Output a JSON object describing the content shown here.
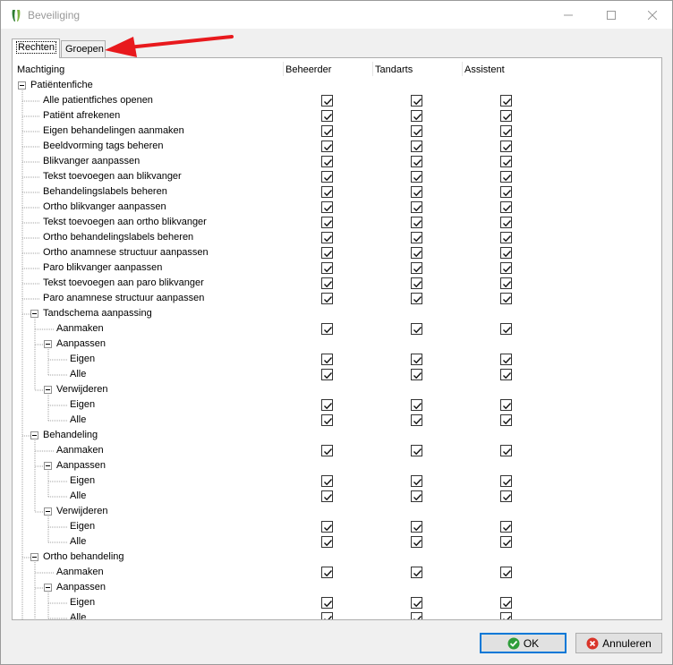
{
  "window": {
    "title": "Beveiliging"
  },
  "tabs": [
    {
      "label": "Rechten",
      "active": true
    },
    {
      "label": "Groepen",
      "active": false
    }
  ],
  "columns": [
    "Machtiging",
    "Beheerder",
    "Tandarts",
    "Assistent"
  ],
  "rows": [
    {
      "label": "Patiëntenfiche",
      "level": 0,
      "expandable": true,
      "checks": false
    },
    {
      "label": "Alle patientfiches openen",
      "level": 1,
      "expandable": false,
      "checks": true
    },
    {
      "label": "Patiënt afrekenen",
      "level": 1,
      "expandable": false,
      "checks": true
    },
    {
      "label": "Eigen behandelingen aanmaken",
      "level": 1,
      "expandable": false,
      "checks": true
    },
    {
      "label": "Beeldvorming tags beheren",
      "level": 1,
      "expandable": false,
      "checks": true
    },
    {
      "label": "Blikvanger aanpassen",
      "level": 1,
      "expandable": false,
      "checks": true
    },
    {
      "label": "Tekst toevoegen aan blikvanger",
      "level": 1,
      "expandable": false,
      "checks": true
    },
    {
      "label": "Behandelingslabels beheren",
      "level": 1,
      "expandable": false,
      "checks": true
    },
    {
      "label": "Ortho blikvanger aanpassen",
      "level": 1,
      "expandable": false,
      "checks": true
    },
    {
      "label": "Tekst toevoegen aan ortho blikvanger",
      "level": 1,
      "expandable": false,
      "checks": true
    },
    {
      "label": "Ortho behandelingslabels beheren",
      "level": 1,
      "expandable": false,
      "checks": true
    },
    {
      "label": "Ortho anamnese structuur aanpassen",
      "level": 1,
      "expandable": false,
      "checks": true
    },
    {
      "label": "Paro blikvanger aanpassen",
      "level": 1,
      "expandable": false,
      "checks": true
    },
    {
      "label": "Tekst toevoegen aan paro blikvanger",
      "level": 1,
      "expandable": false,
      "checks": true
    },
    {
      "label": "Paro anamnese structuur aanpassen",
      "level": 1,
      "expandable": false,
      "checks": true
    },
    {
      "label": "Tandschema aanpassing",
      "level": 1,
      "expandable": true,
      "checks": false
    },
    {
      "label": "Aanmaken",
      "level": 2,
      "expandable": false,
      "checks": true
    },
    {
      "label": "Aanpassen",
      "level": 2,
      "expandable": true,
      "checks": false
    },
    {
      "label": "Eigen",
      "level": 3,
      "expandable": false,
      "checks": true
    },
    {
      "label": "Alle",
      "level": 3,
      "expandable": false,
      "checks": true
    },
    {
      "label": "Verwijderen",
      "level": 2,
      "expandable": true,
      "checks": false
    },
    {
      "label": "Eigen",
      "level": 3,
      "expandable": false,
      "checks": true
    },
    {
      "label": "Alle",
      "level": 3,
      "expandable": false,
      "checks": true
    },
    {
      "label": "Behandeling",
      "level": 1,
      "expandable": true,
      "checks": false
    },
    {
      "label": "Aanmaken",
      "level": 2,
      "expandable": false,
      "checks": true
    },
    {
      "label": "Aanpassen",
      "level": 2,
      "expandable": true,
      "checks": false
    },
    {
      "label": "Eigen",
      "level": 3,
      "expandable": false,
      "checks": true
    },
    {
      "label": "Alle",
      "level": 3,
      "expandable": false,
      "checks": true
    },
    {
      "label": "Verwijderen",
      "level": 2,
      "expandable": true,
      "checks": false
    },
    {
      "label": "Eigen",
      "level": 3,
      "expandable": false,
      "checks": true
    },
    {
      "label": "Alle",
      "level": 3,
      "expandable": false,
      "checks": true
    },
    {
      "label": "Ortho behandeling",
      "level": 1,
      "expandable": true,
      "checks": false
    },
    {
      "label": "Aanmaken",
      "level": 2,
      "expandable": false,
      "checks": true
    },
    {
      "label": "Aanpassen",
      "level": 2,
      "expandable": true,
      "checks": false
    },
    {
      "label": "Eigen",
      "level": 3,
      "expandable": false,
      "checks": true
    },
    {
      "label": "Alle",
      "level": 3,
      "expandable": false,
      "checks": true
    }
  ],
  "buttons": {
    "ok": "OK",
    "cancel": "Annuleren"
  },
  "colors": {
    "accent": "#0078d7",
    "annotation_arrow": "#e8191d"
  }
}
